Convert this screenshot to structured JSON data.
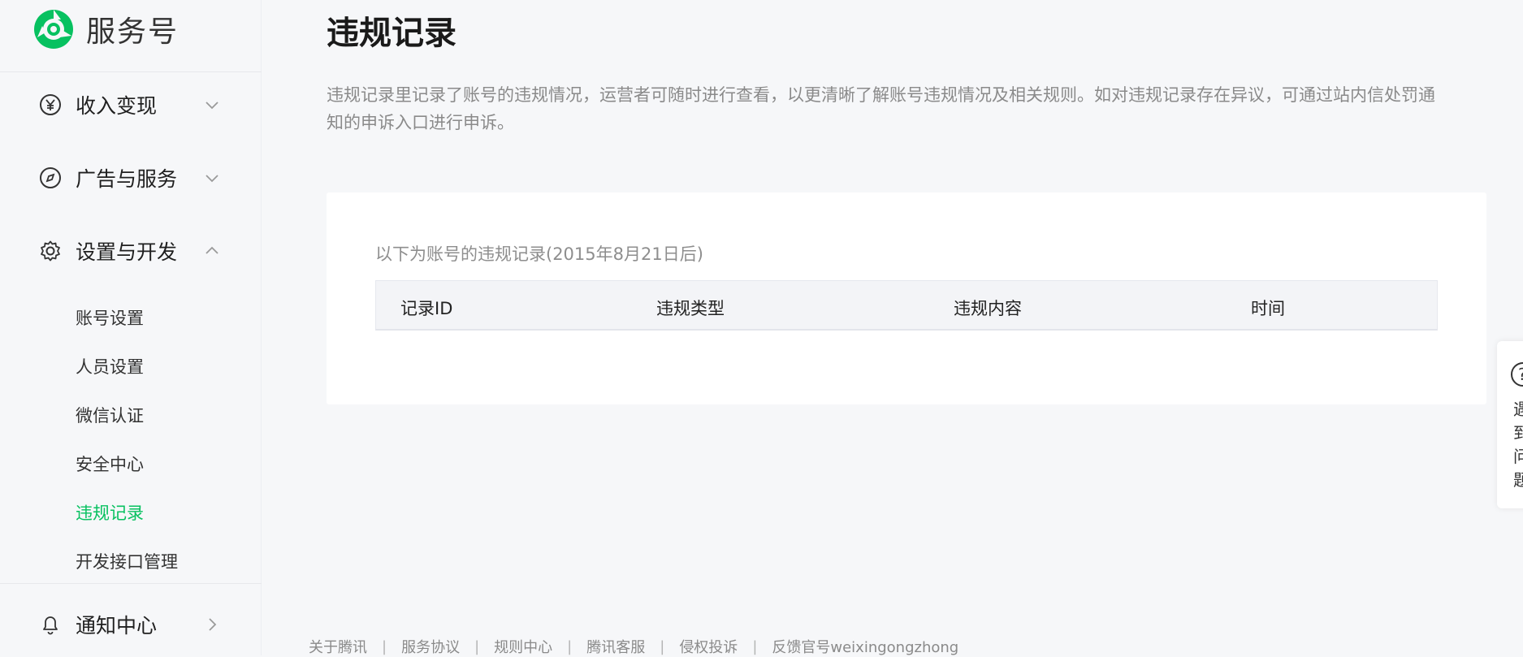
{
  "brand": {
    "name": "服务号",
    "color": "#07c160"
  },
  "sidebar": {
    "groups": [
      {
        "label": "收入变现",
        "icon": "yen-icon",
        "state": "collapsed"
      },
      {
        "label": "广告与服务",
        "icon": "compass-icon",
        "state": "collapsed"
      },
      {
        "label": "设置与开发",
        "icon": "gear-icon",
        "state": "expanded"
      },
      {
        "label": "通知中心",
        "icon": "bell-icon",
        "state": "closed"
      }
    ],
    "sub_items": [
      {
        "label": "账号设置"
      },
      {
        "label": "人员设置"
      },
      {
        "label": "微信认证"
      },
      {
        "label": "安全中心"
      },
      {
        "label": "违规记录",
        "active": true
      },
      {
        "label": "开发接口管理"
      }
    ]
  },
  "main": {
    "title": "违规记录",
    "description": "违规记录里记录了账号的违规情况，运营者可随时进行查看，以更清晰了解账号违规情况及相关规则。如对违规记录存在异议，可通过站内信处罚通知的申诉入口进行申诉。",
    "card": {
      "subtitle": "以下为账号的违规记录(2015年8月21日后)",
      "columns": [
        "记录ID",
        "违规类型",
        "违规内容",
        "时间"
      ]
    }
  },
  "help": {
    "icon": "question-icon",
    "text": "遇到问题"
  },
  "footer": {
    "links": [
      "关于腾讯",
      "服务协议",
      "规则中心",
      "腾讯客服",
      "侵权投诉",
      "反馈官号weixingongzhong"
    ],
    "divider": "|"
  },
  "colors": {
    "accent": "#07c160",
    "background": "#f6f7f9"
  }
}
